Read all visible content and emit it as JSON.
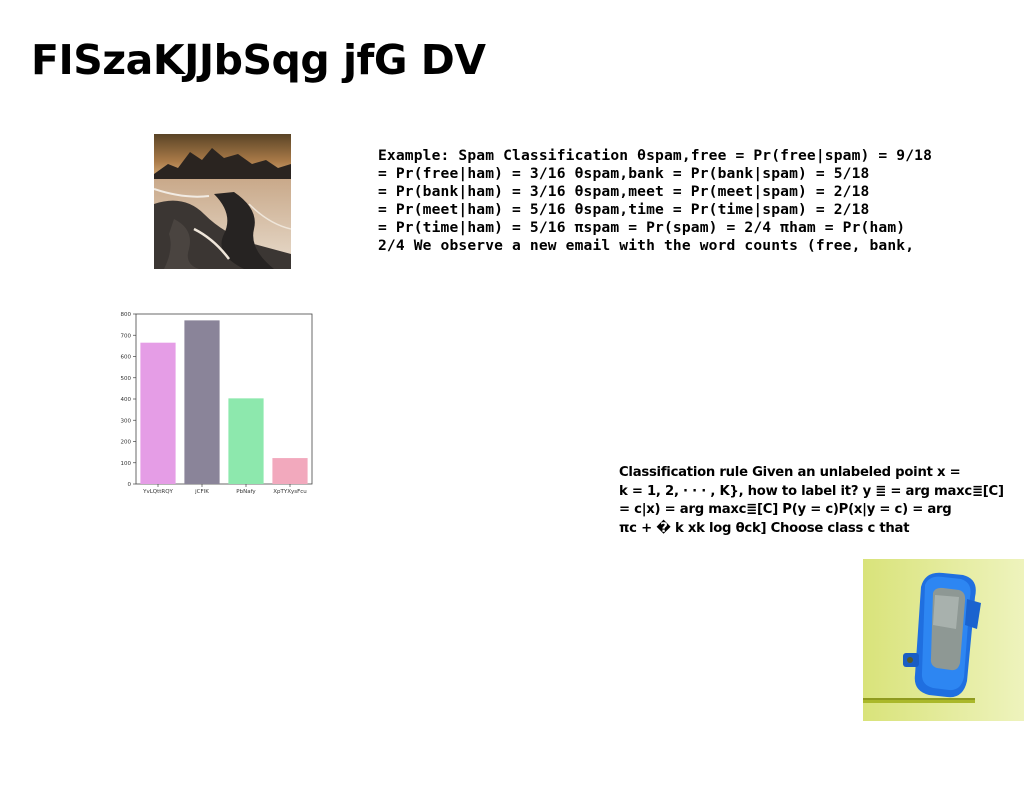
{
  "slide": {
    "title": "FISzaKJJbSqg jfG DV"
  },
  "images": {
    "landscape": {
      "icon": "rocky-seascape-photo"
    },
    "watch": {
      "icon": "blue-smartwatch-photo"
    }
  },
  "example": {
    "lines": [
      "Example: Spam Classification θspam,free = Pr(free|spam) = 9/18",
      "= Pr(free|ham) = 3/16 θspam,bank = Pr(bank|spam) = 5/18",
      "= Pr(bank|ham) = 3/16 θspam,meet = Pr(meet|spam) = 2/18",
      "= Pr(meet|ham) = 5/16 θspam,time = Pr(time|spam) = 2/18",
      "= Pr(time|ham) = 5/16 πspam = Pr(spam) = 2/4 πham = Pr(ham)",
      "2/4 We observe a new email with the word counts (free, bank,"
    ]
  },
  "rule": {
    "lines": [
      "Classification rule Given an unlabeled point x =",
      "k = 1, 2, · · · , K}, how to label it? y ≣ = arg maxc≣[C]",
      "= c|x) = arg maxc≣[C] P(y = c)P(x|y = c) = arg",
      "πc + � k xk log θck] Choose class c that"
    ]
  },
  "chart_data": {
    "type": "bar",
    "categories": [
      "YvLQttRQY",
      "jCFlK",
      "PbNafy",
      "XpTYXysFcu"
    ],
    "values": [
      665,
      770,
      403,
      122
    ],
    "colors": [
      "#e59de6",
      "#8a8499",
      "#8de8ad",
      "#f2a9bd"
    ],
    "yticks": [
      0,
      100,
      200,
      300,
      400,
      500,
      600,
      700,
      800
    ],
    "ylim": [
      0,
      800
    ],
    "title": "",
    "xlabel": "",
    "ylabel": ""
  }
}
